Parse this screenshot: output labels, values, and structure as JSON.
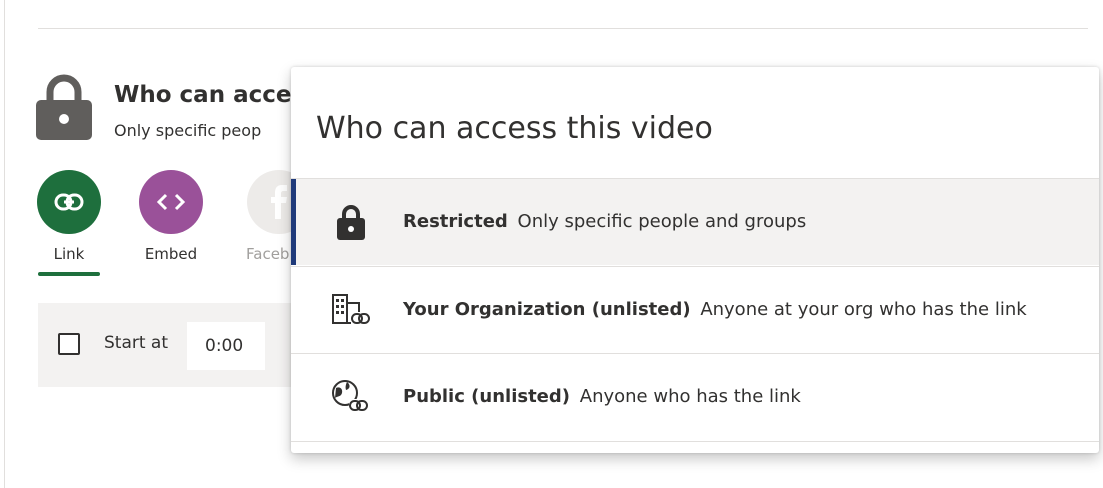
{
  "background": {
    "title": "Who can acce",
    "subtitle": "Only specific peop",
    "share_options": [
      {
        "label": "Link"
      },
      {
        "label": "Embed"
      },
      {
        "label": "Faceb"
      }
    ],
    "start_at": {
      "label": "Start at",
      "value": "0:00"
    }
  },
  "dialog": {
    "title": "Who can access this video",
    "options": [
      {
        "name": "Restricted",
        "description": "Only specific people and groups",
        "icon": "lock-icon",
        "selected": true
      },
      {
        "name": "Your Organization (unlisted)",
        "description": "Anyone at your org who has the link",
        "icon": "organization-link-icon",
        "selected": false
      },
      {
        "name": "Public (unlisted)",
        "description": "Anyone who has the link",
        "icon": "globe-link-icon",
        "selected": false
      }
    ]
  },
  "colors": {
    "link_green": "#1e6f3d",
    "embed_purple": "#9a5199",
    "selection_bar": "#1f3a7a"
  }
}
